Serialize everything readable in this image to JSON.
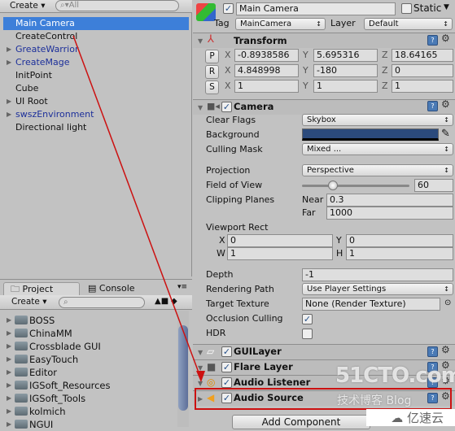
{
  "hierarchy": {
    "create_label": "Create",
    "search_placeholder": "All",
    "items": [
      {
        "label": "Main Camera",
        "selected": true,
        "expandable": false,
        "prefab": false
      },
      {
        "label": "CreateControl",
        "expandable": false,
        "prefab": false
      },
      {
        "label": "GreateWarrior",
        "expandable": true,
        "prefab": true
      },
      {
        "label": "CreateMage",
        "expandable": true,
        "prefab": true
      },
      {
        "label": "InitPoint",
        "expandable": false,
        "prefab": false
      },
      {
        "label": "Cube",
        "expandable": false,
        "prefab": false
      },
      {
        "label": "UI Root",
        "expandable": true,
        "prefab": false
      },
      {
        "label": "swszEnvironment",
        "expandable": true,
        "prefab": true
      },
      {
        "label": "Directional light",
        "expandable": false,
        "prefab": false
      }
    ]
  },
  "project": {
    "tabs": [
      "Project",
      "Console"
    ],
    "create_label": "Create",
    "folders": [
      "BOSS",
      "ChinaMM",
      "Crossblade GUI",
      "EasyTouch",
      "Editor",
      "IGSoft_Resources",
      "IGSoft_Tools",
      "kolmich",
      "NGUI"
    ]
  },
  "inspector": {
    "name": "Main Camera",
    "active": true,
    "static_label": "Static",
    "static": false,
    "tag_label": "Tag",
    "tag": "MainCamera",
    "layer_label": "Layer",
    "layer": "Default",
    "transform": {
      "title": "Transform",
      "rows": [
        {
          "btn": "P",
          "x": "-0.8938586",
          "y": "5.695316",
          "z": "18.64165"
        },
        {
          "btn": "R",
          "x": "4.848998",
          "y": "-180",
          "z": "0"
        },
        {
          "btn": "S",
          "x": "1",
          "y": "1",
          "z": "1"
        }
      ],
      "axis": {
        "x": "X",
        "y": "Y",
        "z": "Z"
      }
    },
    "camera": {
      "title": "Camera",
      "clear_flags_label": "Clear Flags",
      "clear_flags": "Skybox",
      "background_label": "Background",
      "background_color": "#2b4a7c",
      "culling_mask_label": "Culling Mask",
      "culling_mask": "Mixed ...",
      "projection_label": "Projection",
      "projection": "Perspective",
      "fov_label": "Field of View",
      "fov": "60",
      "fov_slider_fraction": 0.29,
      "clipping_label": "Clipping Planes",
      "near_label": "Near",
      "near": "0.3",
      "far_label": "Far",
      "far": "1000",
      "viewport_label": "Viewport Rect",
      "vx": "0",
      "vy": "0",
      "vw": "1",
      "vh": "1",
      "vx_label": "X",
      "vy_label": "Y",
      "vw_label": "W",
      "vh_label": "H",
      "depth_label": "Depth",
      "depth": "-1",
      "rendering_path_label": "Rendering Path",
      "rendering_path": "Use Player Settings",
      "target_texture_label": "Target Texture",
      "target_texture": "None (Render Texture)",
      "occlusion_label": "Occlusion Culling",
      "occlusion": true,
      "hdr_label": "HDR",
      "hdr": false
    },
    "components": [
      {
        "title": "GUILayer"
      },
      {
        "title": "Flare Layer"
      },
      {
        "title": "Audio Listener"
      },
      {
        "title": "Audio Source"
      }
    ],
    "add_component": "Add Component"
  },
  "watermark": {
    "line1": "51CTO.com",
    "line2": "技术博客  Blog",
    "logo": "亿速云"
  },
  "colors": {
    "selection": "#3d7fd9",
    "annotation": "#cc1111"
  }
}
